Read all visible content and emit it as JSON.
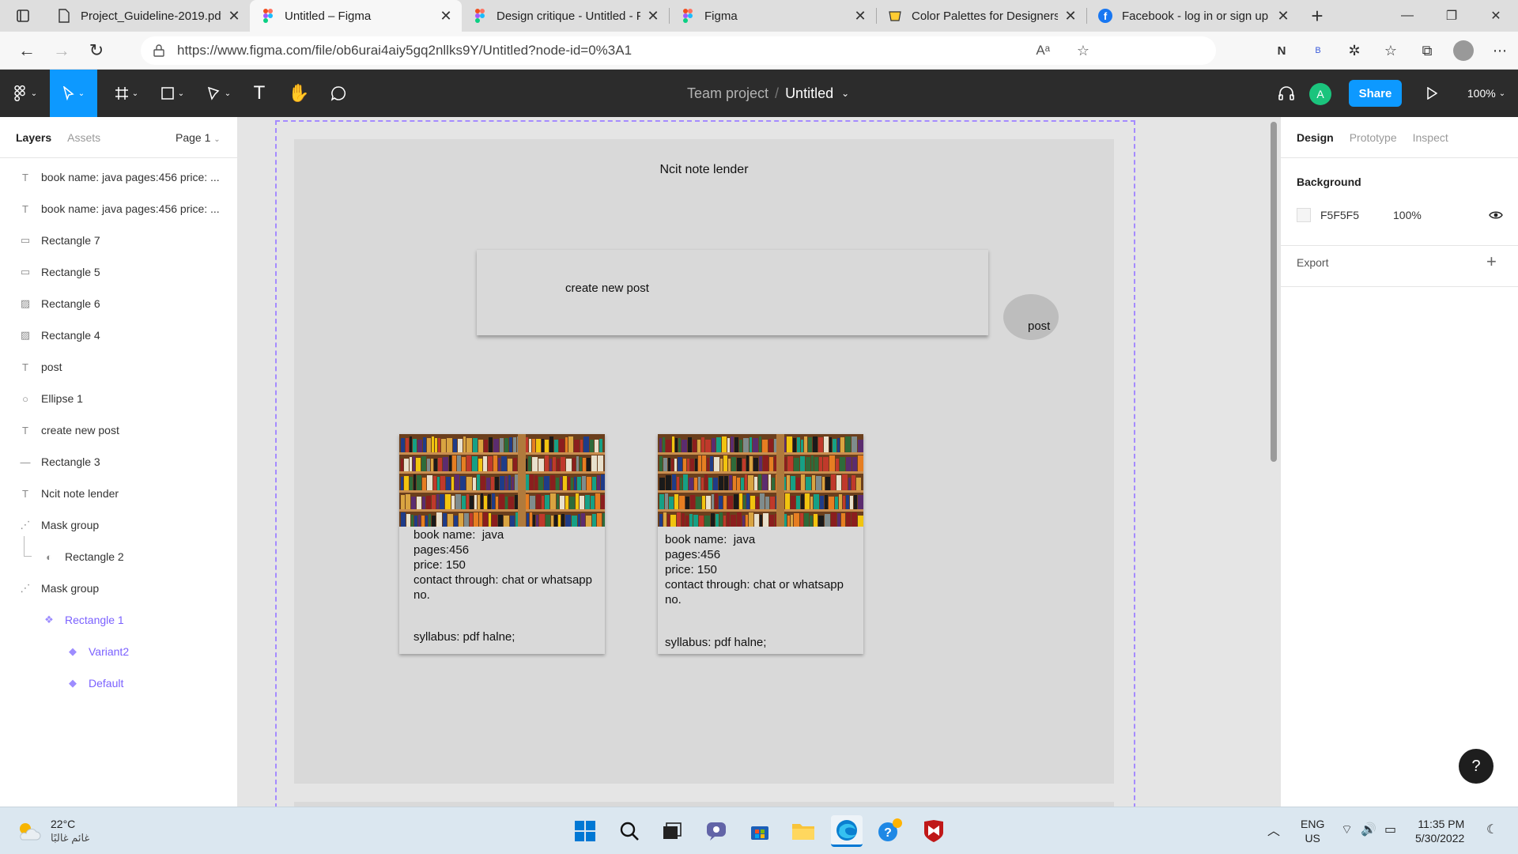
{
  "browser": {
    "tabs": [
      {
        "title": "Project_Guideline-2019.pdf",
        "icon": "pdf-icon",
        "active": false
      },
      {
        "title": "Untitled – Figma",
        "icon": "figma-icon",
        "active": true
      },
      {
        "title": "Design critique - Untitled - F",
        "icon": "figma-icon",
        "active": false
      },
      {
        "title": "Figma",
        "icon": "figma-icon",
        "active": false
      },
      {
        "title": "Color Palettes for Designers",
        "icon": "coolors-icon",
        "active": false
      },
      {
        "title": "Facebook - log in or sign up",
        "icon": "facebook-icon",
        "active": false
      }
    ],
    "url": "https://www.figma.com/file/ob6urai4aiy5gq2nllks9Y/Untitled?node-id=0%3A1"
  },
  "toolbar": {
    "team": "Team project",
    "separator": "/",
    "file_name": "Untitled",
    "share_label": "Share",
    "avatar_letter": "A",
    "zoom": "100%"
  },
  "left_panel": {
    "tab_layers": "Layers",
    "tab_assets": "Assets",
    "page": "Page 1",
    "layers": [
      {
        "name": "book name: java pages:456 price: ...",
        "icon": "text-icon",
        "indent": 0,
        "purple": false
      },
      {
        "name": "book name: java pages:456 price: ...",
        "icon": "text-icon",
        "indent": 0,
        "purple": false
      },
      {
        "name": "Rectangle 7",
        "icon": "rectangle-icon",
        "indent": 0,
        "purple": false
      },
      {
        "name": "Rectangle 5",
        "icon": "rectangle-icon",
        "indent": 0,
        "purple": false
      },
      {
        "name": "Rectangle 6",
        "icon": "image-icon",
        "indent": 0,
        "purple": false
      },
      {
        "name": "Rectangle 4",
        "icon": "image-icon",
        "indent": 0,
        "purple": false
      },
      {
        "name": "post",
        "icon": "text-icon",
        "indent": 0,
        "purple": false
      },
      {
        "name": "Ellipse 1",
        "icon": "ellipse-icon",
        "indent": 0,
        "purple": false
      },
      {
        "name": "create new post",
        "icon": "text-icon",
        "indent": 0,
        "purple": false
      },
      {
        "name": "Rectangle 3",
        "icon": "line-icon",
        "indent": 0,
        "purple": false
      },
      {
        "name": "Ncit note lender",
        "icon": "text-icon",
        "indent": 0,
        "purple": false
      },
      {
        "name": "Mask group",
        "icon": "mask-group-icon",
        "indent": 0,
        "purple": false
      },
      {
        "name": "Rectangle 2",
        "icon": "mask-icon",
        "indent": 1,
        "purple": false
      },
      {
        "name": "Mask group",
        "icon": "mask-group-icon",
        "indent": 0,
        "purple": false
      },
      {
        "name": "Rectangle 1",
        "icon": "component-icon",
        "indent": 1,
        "purple": true
      },
      {
        "name": "Variant2",
        "icon": "variant-icon",
        "indent": 2,
        "purple": true
      },
      {
        "name": "Default",
        "icon": "variant-icon",
        "indent": 2,
        "purple": true
      }
    ]
  },
  "canvas": {
    "frame_title": "Ncit note lender",
    "create_post": "create new post",
    "post_button": "post",
    "cards": [
      {
        "lines": "book name:  java\npages:456\nprice: 150\ncontact through: chat or whatsapp\nno.",
        "syllabus": "syllabus: pdf halne;"
      },
      {
        "lines": "book name:  java\npages:456\nprice: 150\ncontact through: chat or whatsapp\nno.",
        "syllabus": "syllabus: pdf halne;"
      }
    ]
  },
  "right_panel": {
    "tabs": [
      "Design",
      "Prototype",
      "Inspect"
    ],
    "background_label": "Background",
    "bg_hex": "F5F5F5",
    "bg_opacity": "100%",
    "export_label": "Export",
    "help": "?"
  },
  "taskbar": {
    "temp": "22°C",
    "weather_text": "غائم غالبًا",
    "lang_top": "ENG",
    "lang_bottom": "US",
    "time": "11:35 PM",
    "date": "5/30/2022"
  },
  "colors": {
    "figma_blue": "#0d99ff",
    "toolbar_bg": "#2c2c2c",
    "frame_bg": "#d9d9d9",
    "component_purple": "#7b61ff"
  }
}
